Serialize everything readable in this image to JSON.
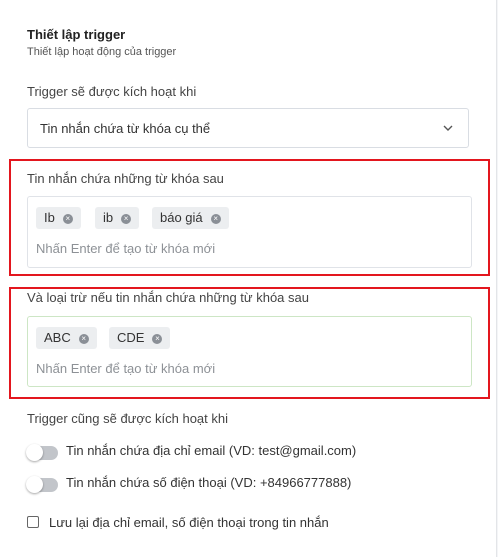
{
  "header": {
    "title": "Thiết lập trigger",
    "subtitle": "Thiết lập hoạt động của trigger"
  },
  "trigger_when": {
    "label": "Trigger sẽ được kích hoạt khi",
    "selected": "Tin nhắn chứa từ khóa cụ thể",
    "icon": "chevron-down-icon"
  },
  "include_keywords": {
    "label": "Tin nhắn chứa những từ khóa sau",
    "tags": [
      "Ib",
      "ib",
      "báo giá"
    ],
    "placeholder": "Nhấn Enter để tạo từ khóa mới"
  },
  "exclude_keywords": {
    "label": "Và loại trừ nếu tin nhắn chứa những từ khóa sau",
    "tags": [
      "ABC",
      "CDE"
    ],
    "placeholder": "Nhấn Enter để tạo từ khóa mới"
  },
  "also_trigger": {
    "label": "Trigger cũng sẽ được kích hoạt khi",
    "options": [
      {
        "label": "Tin nhắn chứa địa chỉ email (VD: test@gmail.com)",
        "enabled": false
      },
      {
        "label": "Tin nhắn chứa số điện thoại (VD: +84966777888)",
        "enabled": false
      }
    ]
  },
  "save_contact": {
    "label": "Lưu lại địa chỉ email, số điện thoại trong tin nhắn",
    "checked": false
  },
  "colors": {
    "highlight_border": "#e3161e",
    "toggle_off": "#c2c5ca"
  }
}
